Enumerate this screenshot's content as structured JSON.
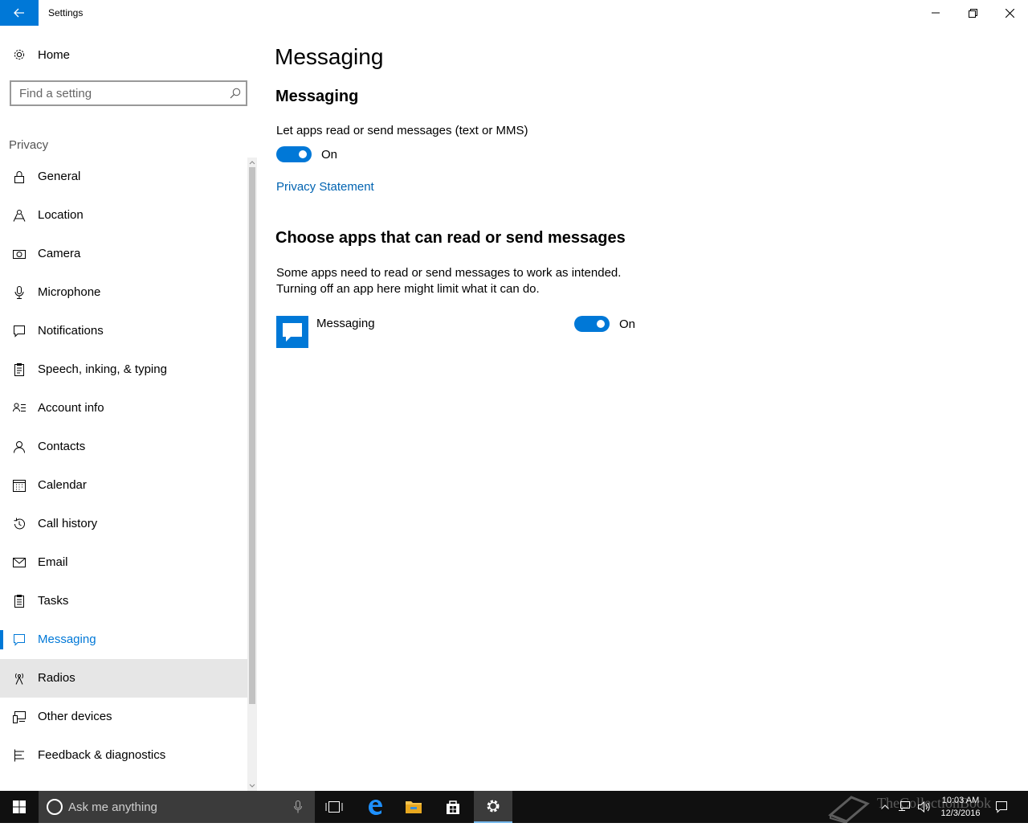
{
  "window": {
    "title": "Settings"
  },
  "sidebar": {
    "home_label": "Home",
    "search_placeholder": "Find a setting",
    "section_label": "Privacy",
    "items": [
      {
        "label": "General",
        "icon": "lock-icon"
      },
      {
        "label": "Location",
        "icon": "location-icon"
      },
      {
        "label": "Camera",
        "icon": "camera-icon"
      },
      {
        "label": "Microphone",
        "icon": "microphone-icon"
      },
      {
        "label": "Notifications",
        "icon": "notification-icon"
      },
      {
        "label": "Speech, inking, & typing",
        "icon": "clipboard-icon"
      },
      {
        "label": "Account info",
        "icon": "account-info-icon"
      },
      {
        "label": "Contacts",
        "icon": "contacts-icon"
      },
      {
        "label": "Calendar",
        "icon": "calendar-icon"
      },
      {
        "label": "Call history",
        "icon": "history-icon"
      },
      {
        "label": "Email",
        "icon": "mail-icon"
      },
      {
        "label": "Tasks",
        "icon": "tasks-icon"
      },
      {
        "label": "Messaging",
        "icon": "message-icon",
        "selected": true
      },
      {
        "label": "Radios",
        "icon": "radio-tower-icon",
        "hover": true
      },
      {
        "label": "Other devices",
        "icon": "devices-icon"
      },
      {
        "label": "Feedback & diagnostics",
        "icon": "feedback-icon"
      }
    ]
  },
  "main": {
    "page_title": "Messaging",
    "section1_heading": "Messaging",
    "setting_label": "Let apps read or send messages (text or MMS)",
    "setting_toggle": {
      "state": "On",
      "on": true
    },
    "privacy_link": "Privacy Statement",
    "section2_heading": "Choose apps that can read or send messages",
    "description_line1": "Some apps need to read or send messages to work as intended.",
    "description_line2": "Turning off an app here might limit what it can do.",
    "apps": [
      {
        "name": "Messaging",
        "state": "On",
        "on": true,
        "icon": "messaging-app-icon"
      }
    ]
  },
  "taskbar": {
    "search_placeholder": "Ask me anything",
    "time": "10:03 AM",
    "date": "12/3/2016",
    "watermark": "TheCollectionBook",
    "accent_color": "#0078d7"
  }
}
